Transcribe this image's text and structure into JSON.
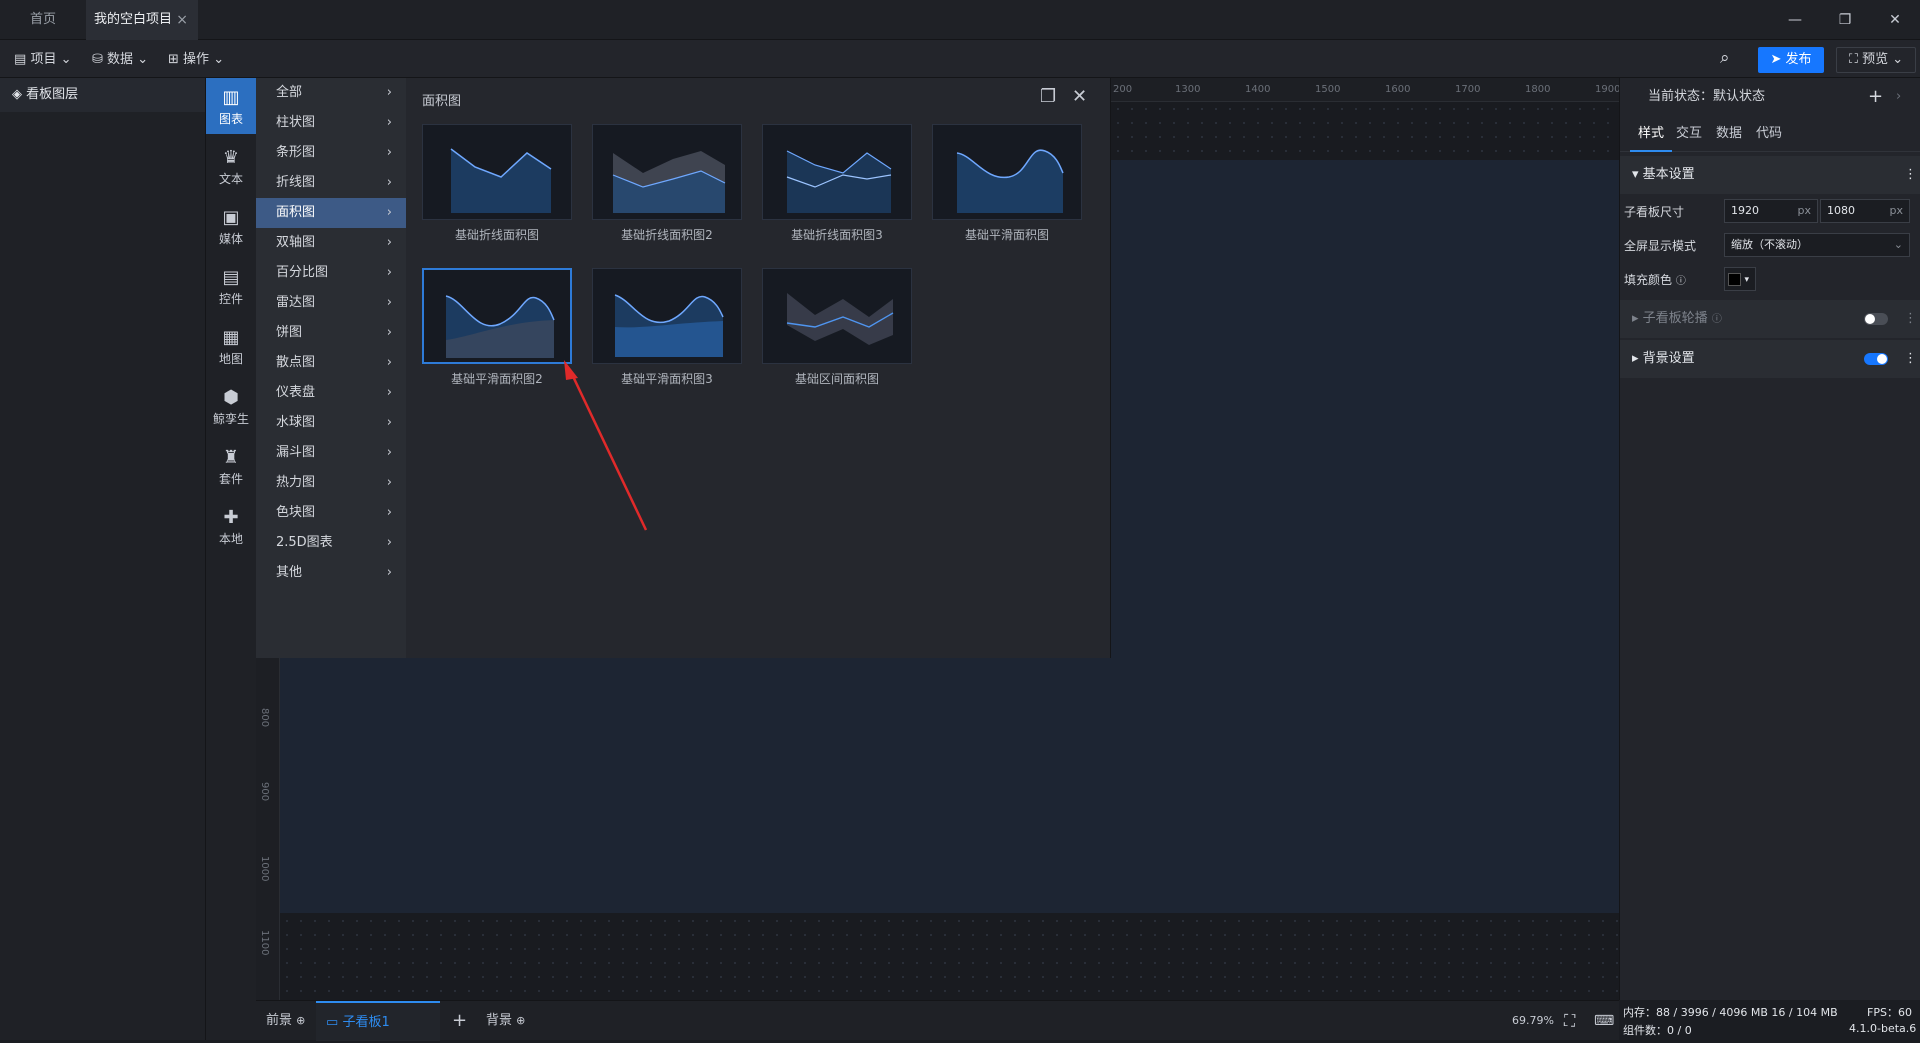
{
  "titlebar": {
    "tabs": [
      {
        "label": "首页"
      },
      {
        "label": "我的空白项目"
      }
    ],
    "close": "×",
    "win": {
      "min": "—",
      "restore": "❐",
      "close": "✕"
    }
  },
  "toolbar": {
    "project": "项目",
    "data": "数据",
    "ops": "操作",
    "publish": "发布",
    "preview": "预览"
  },
  "layers": {
    "title": "看板图层"
  },
  "iconbar": [
    {
      "label": "图表",
      "icon": "chart-icon",
      "glyph": "▥"
    },
    {
      "label": "文本",
      "icon": "text-icon",
      "glyph": "♛"
    },
    {
      "label": "媒体",
      "icon": "media-icon",
      "glyph": "▣"
    },
    {
      "label": "控件",
      "icon": "widget-icon",
      "glyph": "▤"
    },
    {
      "label": "地图",
      "icon": "map-icon",
      "glyph": "▦"
    },
    {
      "label": "鲸孪生",
      "icon": "twin-icon",
      "glyph": "⬢"
    },
    {
      "label": "套件",
      "icon": "kit-icon",
      "glyph": "♜"
    },
    {
      "label": "本地",
      "icon": "local-icon",
      "glyph": "✚"
    }
  ],
  "categories": [
    "全部",
    "柱状图",
    "条形图",
    "折线图",
    "面积图",
    "双轴图",
    "百分比图",
    "雷达图",
    "饼图",
    "散点图",
    "仪表盘",
    "水球图",
    "漏斗图",
    "热力图",
    "色块图",
    "2.5D图表",
    "其他"
  ],
  "gallery": {
    "title": "面积图",
    "items": [
      "基础折线面积图",
      "基础折线面积图2",
      "基础折线面积图3",
      "基础平滑面积图",
      "基础平滑面积图2",
      "基础平滑面积图3",
      "基础区间面积图"
    ]
  },
  "ruler": {
    "h": [
      "200",
      "1300",
      "1400",
      "1500",
      "1600",
      "1700",
      "1800",
      "1900"
    ],
    "v": [
      "800",
      "900",
      "1000",
      "1100"
    ]
  },
  "bottombar": {
    "front": "前景",
    "board": "子看板1",
    "add": "+",
    "back": "背景",
    "zoom": "69.79%"
  },
  "right": {
    "state": "当前状态：默认状态",
    "tabs": [
      "样式",
      "交互",
      "数据",
      "代码"
    ],
    "basic": "基本设置",
    "size_label": "子看板尺寸",
    "width": "1920",
    "height": "1080",
    "unit": "px",
    "fullscreen_label": "全屏显示模式",
    "fullscreen_value": "缩放（不滚动）",
    "fill_label": "填充颜色",
    "carousel": "子看板轮播",
    "bg": "背景设置"
  },
  "status": {
    "mem": "内存：88 / 3996 / 4096 MB 16 / 104 MB",
    "fps": "FPS：60",
    "count": "组件数：0 / 0",
    "version": "4.1.0-beta.6"
  },
  "colors": {
    "accent": "#1677ff",
    "selected": "#3d5a86",
    "iconActive": "#2c6fc0"
  }
}
